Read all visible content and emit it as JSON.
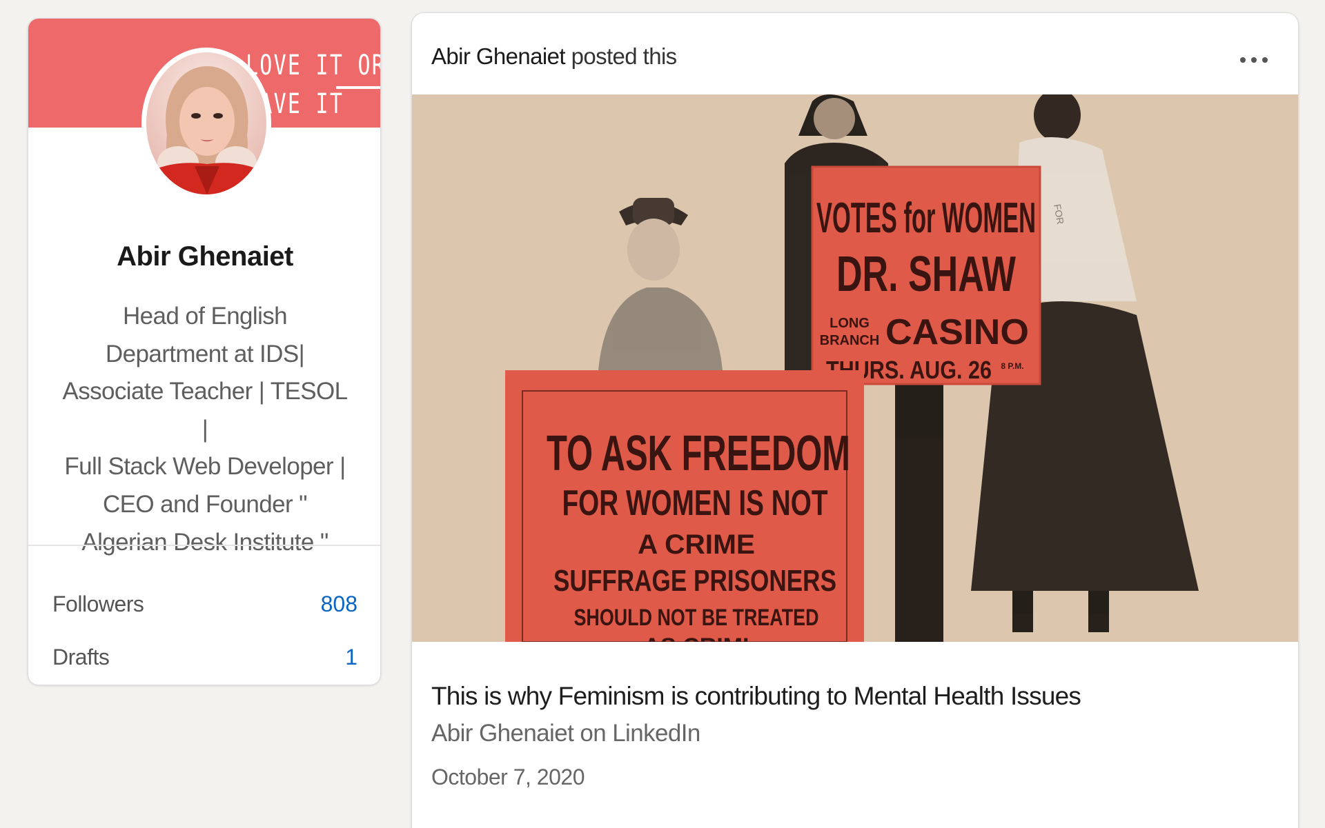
{
  "profile": {
    "cover_text_line1": "LOVE IT OR",
    "cover_text_line2": "EAVE IT",
    "name": "Abir Ghenaiet",
    "headline_lines": [
      "Head of English",
      "Department at IDS|",
      "Associate Teacher | TESOL |",
      "Full Stack Web Developer |",
      "CEO and Founder \"",
      "Algerian Desk Institute \""
    ],
    "stats": [
      {
        "label": "Followers",
        "value": "808"
      },
      {
        "label": "Drafts",
        "value": "1"
      }
    ]
  },
  "post": {
    "author": "Abir Ghenaiet",
    "action": "posted this",
    "more_icon": "ellipsis-icon",
    "image_text": {
      "sign_right": [
        "VOTES for WOMEN",
        "DR. SHAW",
        "LONG",
        "BRANCH",
        "CASINO",
        "THURS. AUG. 26",
        "8 P.M.",
        "FOR"
      ],
      "sign_left": [
        "TO ASK FREEDOM",
        "FOR WOMEN IS NOT",
        "A CRIME",
        "SUFFRAGE PRISONERS",
        "SHOULD NOT BE TREATED",
        "AS CRIMI"
      ]
    },
    "title": "This is why Feminism is contributing to Mental Health Issues",
    "source": "Abir Ghenaiet on LinkedIn",
    "date": "October 7, 2020"
  },
  "colors": {
    "accent": "#0a66c2",
    "cover": "#ee6a6a",
    "sign_red": "#df5a48",
    "image_bg": "#dcc7ae"
  }
}
